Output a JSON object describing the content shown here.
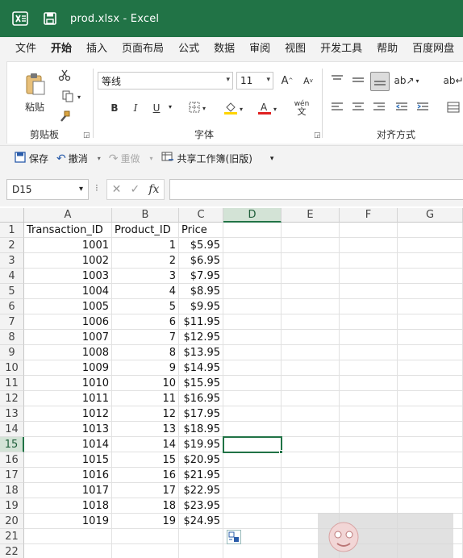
{
  "titlebar": {
    "title": "prod.xlsx  -  Excel"
  },
  "menu": {
    "tabs": [
      "文件",
      "开始",
      "插入",
      "页面布局",
      "公式",
      "数据",
      "审阅",
      "视图",
      "开发工具",
      "帮助",
      "百度网盘"
    ]
  },
  "ribbon": {
    "clipboard": {
      "paste_label": "粘贴",
      "group_label": "剪贴板"
    },
    "font": {
      "font_name": "等线",
      "font_size": "11",
      "group_label": "字体",
      "bold": "B",
      "italic": "I",
      "underline": "U",
      "wen": "wén",
      "wen_char": "文"
    },
    "alignment": {
      "group_label": "对齐方式"
    }
  },
  "qat": {
    "save_label": "保存",
    "undo_label": "撤消",
    "redo_label": "重做",
    "share_label": "共享工作簿(旧版)"
  },
  "formula_bar": {
    "name_box": "D15",
    "fx": "fx",
    "formula": ""
  },
  "sheet": {
    "columns": [
      "A",
      "B",
      "C",
      "D",
      "E",
      "F",
      "G"
    ],
    "selected_column": "D",
    "selected_row": "15",
    "row_numbers": [
      "1",
      "2",
      "3",
      "4",
      "5",
      "6",
      "7",
      "8",
      "9",
      "10",
      "11",
      "12",
      "13",
      "14",
      "15",
      "16",
      "17",
      "18",
      "19",
      "20",
      "21",
      "22"
    ],
    "headers": [
      "Transaction_ID",
      "Product_ID",
      "Price"
    ],
    "rows": [
      [
        "1001",
        "1",
        "$5.95"
      ],
      [
        "1002",
        "2",
        "$6.95"
      ],
      [
        "1003",
        "3",
        "$7.95"
      ],
      [
        "1004",
        "4",
        "$8.95"
      ],
      [
        "1005",
        "5",
        "$9.95"
      ],
      [
        "1006",
        "6",
        "$11.95"
      ],
      [
        "1007",
        "7",
        "$12.95"
      ],
      [
        "1008",
        "8",
        "$13.95"
      ],
      [
        "1009",
        "9",
        "$14.95"
      ],
      [
        "1010",
        "10",
        "$15.95"
      ],
      [
        "1011",
        "11",
        "$16.95"
      ],
      [
        "1012",
        "12",
        "$17.95"
      ],
      [
        "1013",
        "13",
        "$18.95"
      ],
      [
        "1014",
        "14",
        "$19.95"
      ],
      [
        "1015",
        "15",
        "$20.95"
      ],
      [
        "1016",
        "16",
        "$21.95"
      ],
      [
        "1017",
        "17",
        "$22.95"
      ],
      [
        "1018",
        "18",
        "$23.95"
      ],
      [
        "1019",
        "19",
        "$24.95"
      ]
    ]
  },
  "colors": {
    "accent": "#217346",
    "font_color_bar": "#e02020",
    "highlight_bar": "#ffd400"
  }
}
